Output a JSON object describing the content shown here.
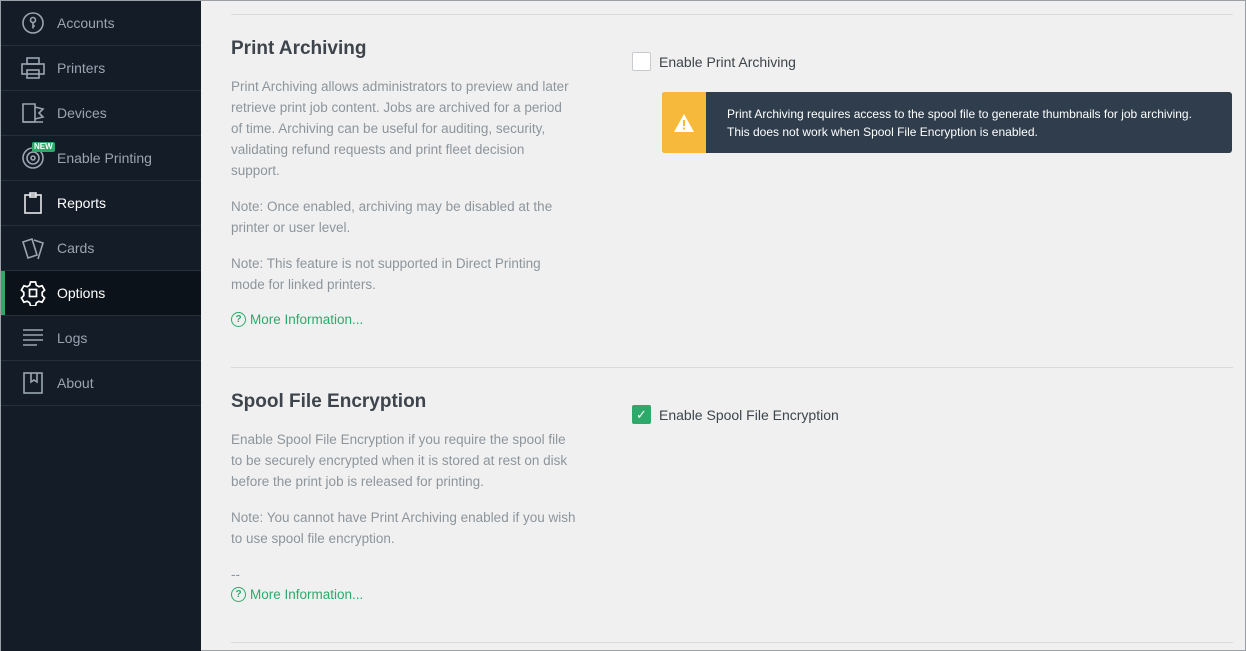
{
  "sidebar": {
    "items": [
      {
        "label": "Accounts",
        "icon": "key-icon"
      },
      {
        "label": "Printers",
        "icon": "printer-icon"
      },
      {
        "label": "Devices",
        "icon": "device-icon"
      },
      {
        "label": "Enable Printing",
        "icon": "target-icon",
        "badge": "NEW"
      },
      {
        "label": "Reports",
        "icon": "clipboard-icon"
      },
      {
        "label": "Cards",
        "icon": "cards-icon"
      },
      {
        "label": "Options",
        "icon": "gear-icon"
      },
      {
        "label": "Logs",
        "icon": "lines-icon"
      },
      {
        "label": "About",
        "icon": "bookmark-icon"
      }
    ],
    "active": "Options"
  },
  "print_archiving": {
    "title": "Print Archiving",
    "desc1": "Print Archiving allows administrators to preview and later retrieve print job content. Jobs are archived for a period of time. Archiving can be useful for auditing, security, validating refund requests and print fleet decision support.",
    "desc2": "Note: Once enabled, archiving may be disabled at the printer or user level.",
    "desc3": "Note: This feature is not supported in Direct Printing mode for linked printers.",
    "more": "More Information...",
    "checkbox_label": "Enable Print Archiving",
    "checked": false,
    "warning_line1": "Print Archiving requires access to the spool file to generate thumbnails for job archiving.",
    "warning_line2": "This does not work when Spool File Encryption is enabled."
  },
  "spool_encryption": {
    "title": "Spool File Encryption",
    "desc1": "Enable Spool File Encryption if you require the spool file to be securely encrypted when it is stored at rest on disk before the print job is released for printing.",
    "desc2": "Note: You cannot have Print Archiving enabled if you wish to use spool file encryption.",
    "desc3": "--",
    "more": "More Information...",
    "checkbox_label": "Enable Spool File Encryption",
    "checked": true
  },
  "colors": {
    "accent": "#2ea96a",
    "sidebar_bg": "#131c27",
    "warning": "#f6b93b",
    "warning_bg": "#2f3d4c"
  }
}
